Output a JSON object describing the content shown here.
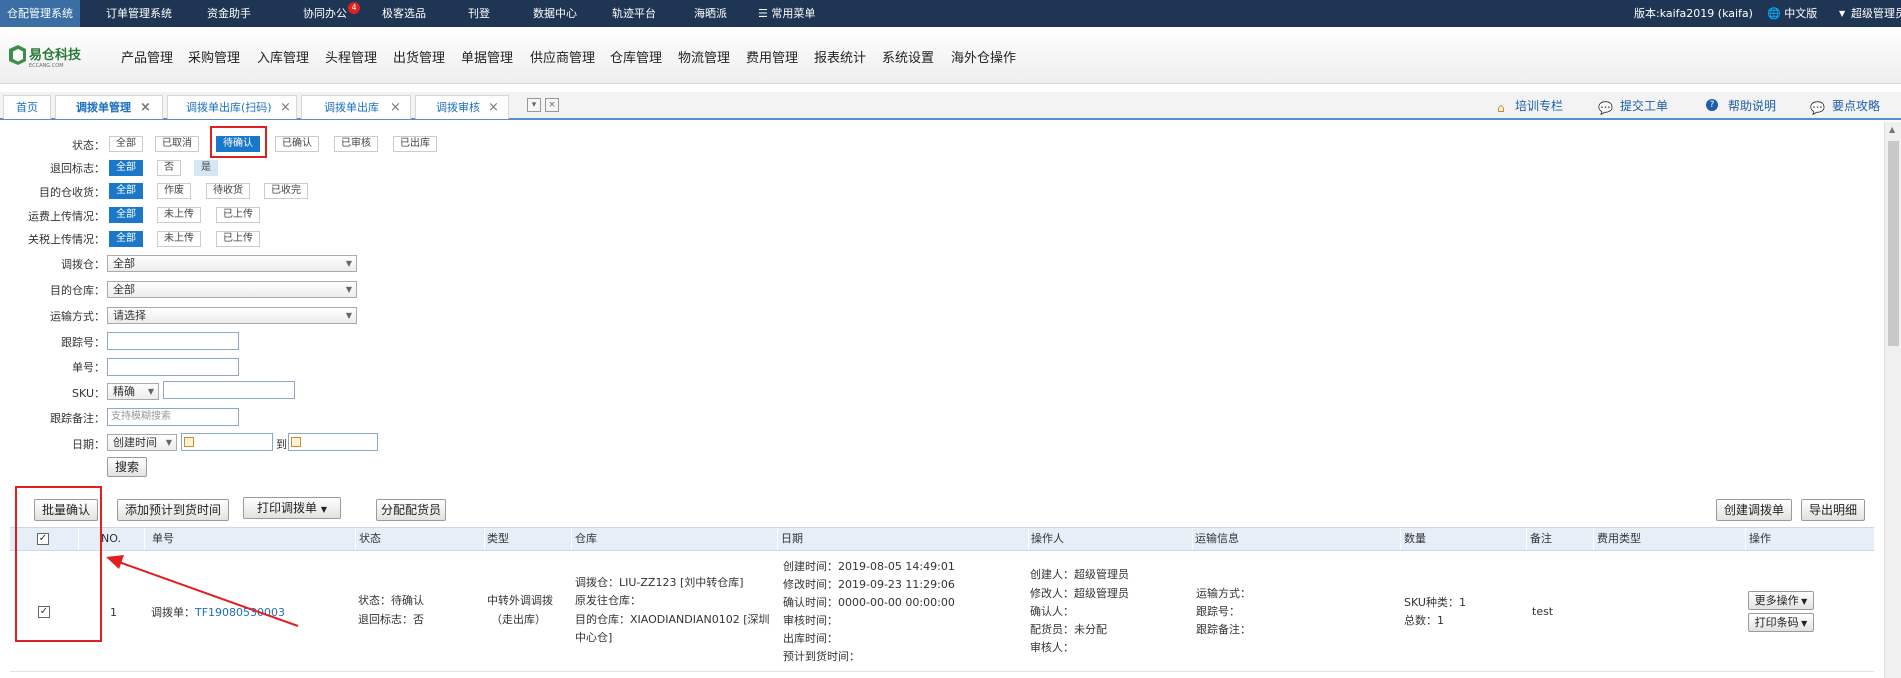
{
  "topnav": {
    "items": [
      "仓配管理系统",
      "订单管理系统",
      "资金助手",
      "协同办公",
      "极客选品",
      "刊登",
      "数据中心",
      "轨迹平台",
      "海晒派",
      "常用菜单"
    ],
    "badge_count": "4",
    "version_text": "版本:kaifa2019 (kaifa)",
    "language": "中文版",
    "user": "超级管理员"
  },
  "logo": {
    "text": "易仓科技"
  },
  "mainmenu": [
    "产品管理",
    "采购管理",
    "入库管理",
    "头程管理",
    "出货管理",
    "单据管理",
    "供应商管理",
    "仓库管理",
    "物流管理",
    "费用管理",
    "报表统计",
    "系统设置",
    "海外仓操作"
  ],
  "tabs": [
    {
      "label": "首页"
    },
    {
      "label": "调拨单管理"
    },
    {
      "label": "调拨单出库(扫码)"
    },
    {
      "label": "调拨单出库"
    },
    {
      "label": "调拨审核"
    }
  ],
  "rightlinks": [
    "培训专栏",
    "提交工单",
    "帮助说明",
    "要点攻略"
  ],
  "filters": {
    "status": {
      "label": "状态：",
      "options": [
        "全部",
        "已取消",
        "待确认",
        "已确认",
        "已审核",
        "已出库"
      ]
    },
    "return_flag": {
      "label": "退回标志：",
      "options": [
        "全部",
        "否",
        "是"
      ]
    },
    "dest_receive": {
      "label": "目的仓收货：",
      "options": [
        "全部",
        "作废",
        "待收货",
        "已收完"
      ]
    },
    "freight_upload": {
      "label": "运费上传情况：",
      "options": [
        "全部",
        "未上传",
        "已上传"
      ]
    },
    "tariff_upload": {
      "label": "关税上传情况：",
      "options": [
        "全部",
        "未上传",
        "已上传"
      ]
    },
    "source_wh": {
      "label": "调拨仓：",
      "value": "全部"
    },
    "dest_wh": {
      "label": "目的仓库：",
      "value": "全部"
    },
    "shipping": {
      "label": "运输方式：",
      "value": "请选择"
    },
    "tracking": {
      "label": "跟踪号："
    },
    "order_no": {
      "label": "单号："
    },
    "sku": {
      "label": "SKU：",
      "mode": "精确"
    },
    "track_note": {
      "label": "跟踪备注：",
      "placeholder": "支持模糊搜索"
    },
    "date": {
      "label": "日期：",
      "type": "创建时间",
      "to": "到"
    },
    "search_btn": "搜索"
  },
  "actions": {
    "batch_confirm": "批量确认",
    "add_eta": "添加预计到货时间",
    "print": "打印调拨单",
    "assign": "分配配货员",
    "create": "创建调拨单",
    "export": "导出明细"
  },
  "table": {
    "headers": [
      "NO.",
      "单号",
      "状态",
      "类型",
      "仓库",
      "日期",
      "操作人",
      "运输信息",
      "数量",
      "备注",
      "费用类型",
      "操作"
    ],
    "rows": [
      {
        "no": "1",
        "order_label": "调拨单：",
        "order_no": "TF19080530003",
        "status": [
          "状态：待确认",
          "退回标志：否"
        ],
        "type": [
          "中转外调调拨",
          "（走出库）"
        ],
        "warehouse": [
          "调拨仓：LIU-ZZ123 [刘中转仓库]",
          "原发往仓库：",
          "目的仓库：XIAODIANDIAN0102 [深圳",
          "中心仓]"
        ],
        "dates": [
          "创建时间：2019-08-05 14:49:01",
          "修改时间：2019-09-23 11:29:06",
          "确认时间：0000-00-00 00:00:00",
          "审核时间：",
          "出库时间：",
          "预计到货时间："
        ],
        "operators": [
          "创建人：超级管理员",
          "修改人：超级管理员",
          "确认人：",
          "配货员：未分配",
          "审核人："
        ],
        "shipping": [
          "运输方式：",
          "跟踪号：",
          "跟踪备注："
        ],
        "quantity": [
          "SKU种类：1",
          "总数：1"
        ],
        "remark": "test",
        "ops": [
          "更多操作",
          "打印条码"
        ]
      }
    ]
  }
}
